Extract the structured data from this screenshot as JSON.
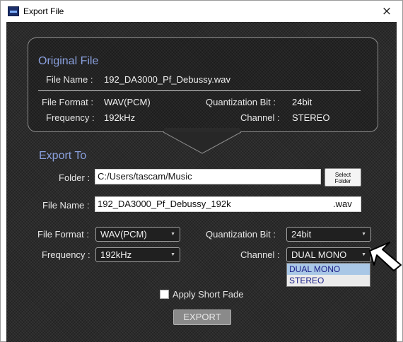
{
  "window": {
    "title": "Export File",
    "close_symbol": "×"
  },
  "original_file": {
    "title": "Original File",
    "file_name_label": "File Name :",
    "file_name": "192_DA3000_Pf_Debussy.wav",
    "file_format_label": "File Format :",
    "file_format": "WAV(PCM)",
    "quantization_label": "Quantization Bit :",
    "quantization": "24bit",
    "frequency_label": "Frequency :",
    "frequency": "192kHz",
    "channel_label": "Channel :",
    "channel": "STEREO"
  },
  "export_to": {
    "title": "Export To",
    "folder_label": "Folder :",
    "folder_value": "C:/Users/tascam/Music",
    "select_folder_line1": "Select",
    "select_folder_line2": "Folder",
    "file_name_label": "File Name :",
    "file_name_value": "192_DA3000_Pf_Debussy_192k",
    "extension": ".wav",
    "file_format_label": "File Format :",
    "file_format_value": "WAV(PCM)",
    "quantization_label": "Quantization Bit :",
    "quantization_value": "24bit",
    "frequency_label": "Frequency :",
    "frequency_value": "192kHz",
    "channel_label": "Channel :",
    "channel_value": "DUAL MONO",
    "channel_options": [
      "DUAL MONO",
      "STEREO"
    ],
    "apply_short_fade_label": "Apply Short Fade",
    "apply_short_fade_checked": false,
    "export_button": "EXPORT"
  }
}
